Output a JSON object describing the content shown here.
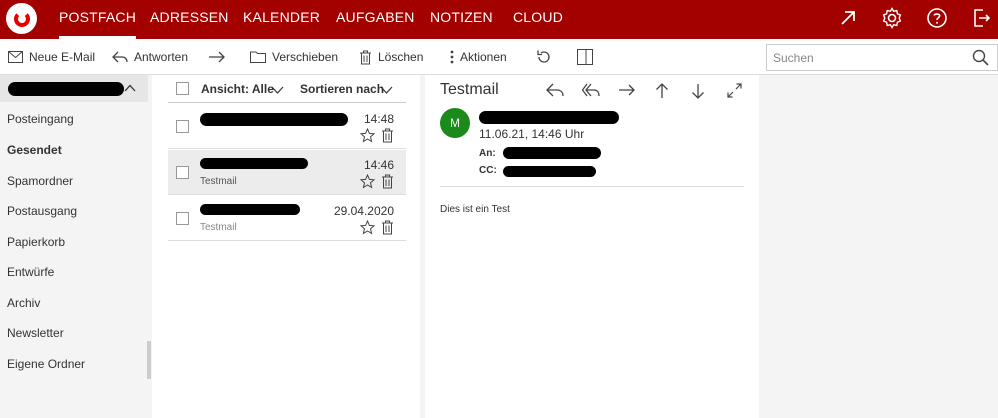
{
  "nav": {
    "tabs": [
      {
        "label": "POSTFACH",
        "active": true
      },
      {
        "label": "ADRESSEN"
      },
      {
        "label": "KALENDER"
      },
      {
        "label": "AUFGABEN"
      },
      {
        "label": "NOTIZEN"
      },
      {
        "label": "CLOUD"
      }
    ],
    "icons": [
      "external-link-icon",
      "gear-icon",
      "help-icon",
      "logout-icon"
    ]
  },
  "toolbar": {
    "new_mail": "Neue E-Mail",
    "reply": "Antworten",
    "move": "Verschieben",
    "delete": "Löschen",
    "actions": "Aktionen",
    "search_placeholder": "Suchen"
  },
  "sidebar": {
    "folders": [
      {
        "label": "Posteingang"
      },
      {
        "label": "Gesendet",
        "active": true
      },
      {
        "label": "Spamordner"
      },
      {
        "label": "Postausgang"
      },
      {
        "label": "Papierkorb"
      },
      {
        "label": "Entwürfe"
      },
      {
        "label": "Archiv"
      },
      {
        "label": "Newsletter"
      },
      {
        "label": "Eigene Ordner"
      }
    ]
  },
  "list": {
    "view_label": "Ansicht: Alle",
    "sort_label": "Sortieren nach",
    "messages": [
      {
        "time": "14:48",
        "subject": ""
      },
      {
        "time": "14:46",
        "subject": "Testmail",
        "selected": true
      },
      {
        "time": "29.04.2020",
        "subject": "Testmail"
      }
    ]
  },
  "reader": {
    "title": "Testmail",
    "avatar_letter": "M",
    "date": "11.06.21, 14:46 Uhr",
    "to_label": "An:",
    "cc_label": "CC:",
    "body": "Dies ist ein Test"
  },
  "colors": {
    "brand": "#a30000",
    "avatar": "#1a8a1a"
  }
}
